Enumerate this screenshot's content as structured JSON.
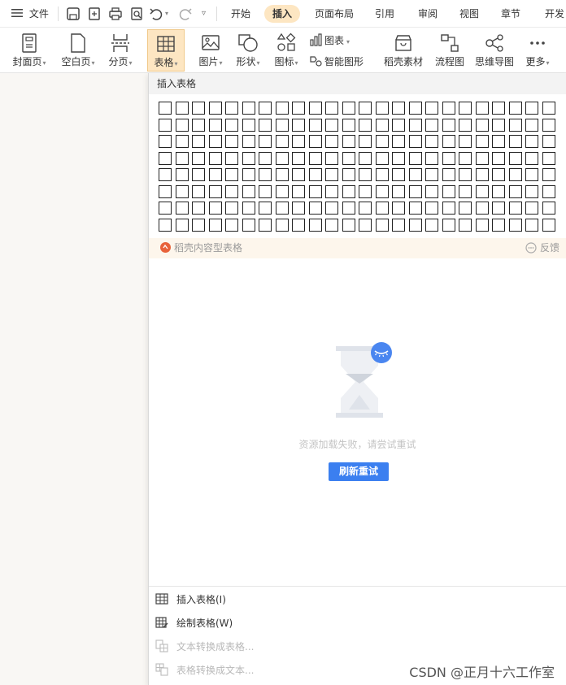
{
  "menubar": {
    "file_label": "文件",
    "tabs": [
      "开始",
      "插入",
      "页面布局",
      "引用",
      "审阅",
      "视图",
      "章节",
      "开发"
    ],
    "active_tab": "插入"
  },
  "ribbon": {
    "cover_page": "封面页",
    "blank_page": "空白页",
    "page_break": "分页",
    "table": "表格",
    "picture": "图片",
    "shape": "形状",
    "icon": "图标",
    "chart": "图表",
    "smart_graphic": "智能图形",
    "docer_material": "稻壳素材",
    "flowchart": "流程图",
    "mind_map": "思维导图",
    "more": "更多"
  },
  "panel": {
    "header": "插入表格",
    "grid_rows": 8,
    "grid_cols": 24,
    "docer_table_label": "稻壳内容型表格",
    "feedback_label": "反馈",
    "load_fail_msg": "资源加载失败，请尝试重试",
    "retry_button": "刷新重试",
    "footer": {
      "insert_table": "插入表格(I)",
      "draw_table": "绘制表格(W)",
      "text_to_table": "文本转换成表格...",
      "table_to_text": "表格转换成文本..."
    }
  },
  "colors": {
    "accent_blue": "#3b7ff0",
    "active_tab_bg": "#fde6c2",
    "docer_orange": "#e8623a"
  },
  "watermark": "CSDN @正月十六工作室"
}
